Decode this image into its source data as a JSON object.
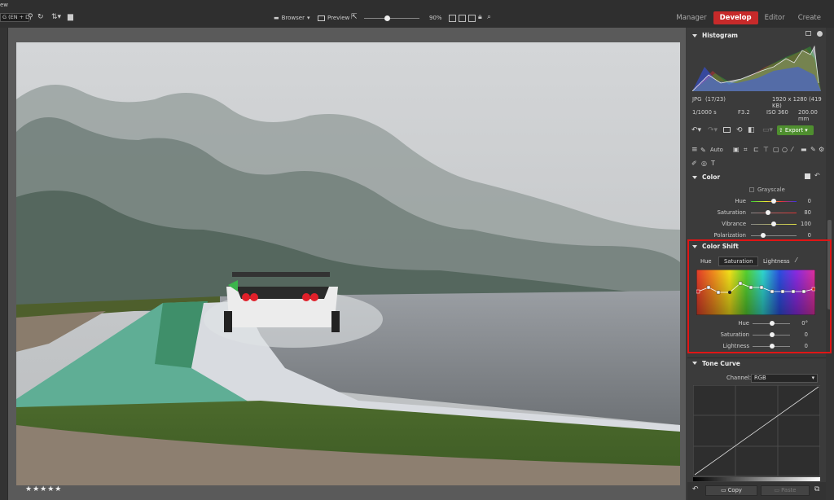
{
  "window": {
    "title_fragment": "ew"
  },
  "toolbar": {
    "language_input": "G (EN + DE",
    "browser_label": "Browser",
    "preview_label": "Preview",
    "zoom_value": "90%",
    "zoom_level": 0.4
  },
  "modes": [
    "Manager",
    "Develop",
    "Editor",
    "Create"
  ],
  "active_mode": "Develop",
  "rating": "★★★★★",
  "histogram": {
    "title": "Histogram",
    "file_format": "JPG",
    "file_index": "(17/23)",
    "dimensions": "1920 x 1280 (419 KB)",
    "shutter": "1/1000 s",
    "aperture": "F3.2",
    "iso": "ISO 360",
    "focal": "200.00 mm"
  },
  "actions": {
    "export_label": "Export"
  },
  "tools": {
    "auto_label": "Auto"
  },
  "color": {
    "title": "Color",
    "grayscale_label": "Grayscale",
    "sliders": [
      {
        "label": "Hue",
        "value": "0",
        "level": 0.5
      },
      {
        "label": "Saturation",
        "value": "80",
        "level": 0.03
      },
      {
        "label": "Vibrance",
        "value": "100",
        "level": 0.5
      },
      {
        "label": "Polarization",
        "value": "0",
        "level": 0.0
      }
    ]
  },
  "color_shift": {
    "title": "Color Shift",
    "tabs": [
      "Hue",
      "Saturation",
      "Lightness"
    ],
    "active_tab": "Saturation",
    "sliders": [
      {
        "label": "Hue",
        "value": "0°",
        "level": 0.5
      },
      {
        "label": "Saturation",
        "value": "0",
        "level": 0.5
      },
      {
        "label": "Lightness",
        "value": "0",
        "level": 0.5
      }
    ]
  },
  "tone_curve": {
    "title": "Tone Curve",
    "channel_label": "Channel:",
    "channel_value": "RGB"
  },
  "bottom": {
    "copy_label": "Copy",
    "paste_label": "Paste"
  },
  "colors": {
    "accent": "#c72a2a",
    "highlight": "#e01515",
    "export_green": "#4f8f2f"
  }
}
